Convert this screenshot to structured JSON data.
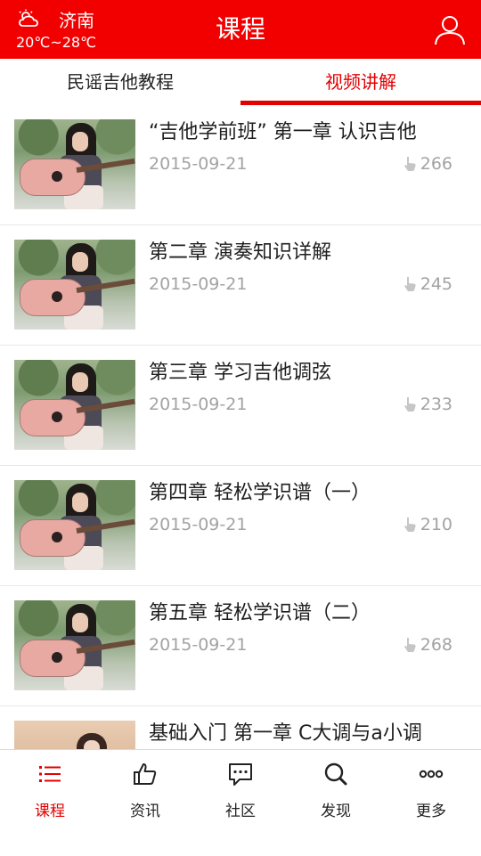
{
  "header": {
    "city": "济南",
    "temperature": "20℃~28℃",
    "title": "课程",
    "weather_icon": "cloudy-sun-icon",
    "user_icon": "user-icon"
  },
  "tabs": [
    {
      "label": "民谣吉他教程",
      "active": false
    },
    {
      "label": "视频讲解",
      "active": true
    }
  ],
  "lessons": [
    {
      "title": "“吉他学前班” 第一章 认识吉他",
      "date": "2015-09-21",
      "likes": "266"
    },
    {
      "title": "第二章 演奏知识详解",
      "date": "2015-09-21",
      "likes": "245"
    },
    {
      "title": "第三章 学习吉他调弦",
      "date": "2015-09-21",
      "likes": "233"
    },
    {
      "title": "第四章 轻松学识谱（一）",
      "date": "2015-09-21",
      "likes": "210"
    },
    {
      "title": "第五章 轻松学识谱（二）",
      "date": "2015-09-21",
      "likes": "268"
    },
    {
      "title": "基础入门 第一章 C大调与a小调",
      "date": "",
      "likes": ""
    }
  ],
  "bottom_nav": [
    {
      "label": "课程",
      "icon": "list-icon",
      "active": true
    },
    {
      "label": "资讯",
      "icon": "thumbs-up-icon",
      "active": false
    },
    {
      "label": "社区",
      "icon": "chat-icon",
      "active": false
    },
    {
      "label": "发现",
      "icon": "search-icon",
      "active": false
    },
    {
      "label": "更多",
      "icon": "more-icon",
      "active": false
    }
  ],
  "colors": {
    "brand_red": "#f20000",
    "active_red": "#e30000",
    "muted_text": "#a3a3a3"
  }
}
